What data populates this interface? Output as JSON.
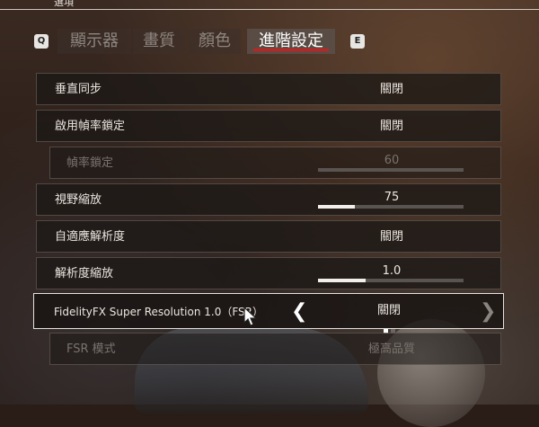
{
  "header": {
    "title": "選項"
  },
  "tabs": {
    "prev_key": "Q",
    "next_key": "E",
    "items": [
      "顯示器",
      "畫質",
      "顏色",
      "進階設定"
    ],
    "active": "進階設定"
  },
  "settings": [
    {
      "label": "垂直同步",
      "value": "關閉",
      "type": "toggle",
      "enabled": true
    },
    {
      "label": "啟用幀率鎖定",
      "value": "關閉",
      "type": "toggle",
      "enabled": true
    },
    {
      "label": "幀率鎖定",
      "value": "60",
      "type": "slider",
      "fill_fraction": 0.0,
      "enabled": false
    },
    {
      "label": "視野縮放",
      "value": "75",
      "type": "slider",
      "fill_fraction": 0.25,
      "enabled": true
    },
    {
      "label": "自適應解析度",
      "value": "關閉",
      "type": "toggle",
      "enabled": true
    },
    {
      "label": "解析度縮放",
      "value": "1.0",
      "type": "slider",
      "fill_fraction": 0.33,
      "enabled": true
    },
    {
      "label": "FidelityFX Super Resolution 1.0（FSR）",
      "value": "關閉",
      "type": "selector",
      "selected": true,
      "page": 1,
      "pages": 2,
      "enabled": true
    },
    {
      "label": "FSR 模式",
      "value": "極高品質",
      "type": "selector",
      "enabled": false
    }
  ],
  "icons": {
    "left_arrow": "chevron-left-icon",
    "right_arrow": "chevron-right-icon",
    "cursor": "mouse-cursor-icon"
  },
  "colors": {
    "accent_underline": "#c42222",
    "text": "#ece6e0",
    "disabled_text": "#7a736e"
  }
}
